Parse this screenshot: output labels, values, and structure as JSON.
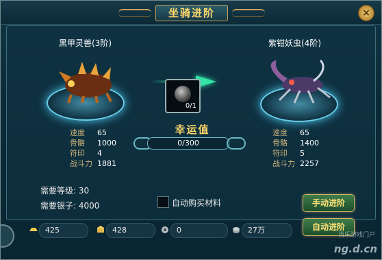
{
  "window": {
    "title": "坐骑进阶"
  },
  "current_mount": {
    "name": "黑甲灵兽(3阶)",
    "stats": [
      {
        "label": "速度",
        "value": "65"
      },
      {
        "label": "骨骼",
        "value": "1000"
      },
      {
        "label": "符印",
        "value": "4"
      },
      {
        "label": "战斗力",
        "value": "1881"
      }
    ]
  },
  "next_mount": {
    "name": "紫钳妖虫(4阶)",
    "stats": [
      {
        "label": "速度",
        "value": "65"
      },
      {
        "label": "骨骼",
        "value": "1400"
      },
      {
        "label": "符印",
        "value": "5"
      },
      {
        "label": "战斗力",
        "value": "2257"
      }
    ]
  },
  "material_slot": {
    "count": "0/1"
  },
  "luck": {
    "title": "幸运值",
    "value": "0/300",
    "progress": 0
  },
  "requirements": {
    "level": "需要等级: 30",
    "silver": "需要银子: 4000"
  },
  "auto_buy": {
    "label": "自动购买材料",
    "checked": false
  },
  "buttons": {
    "manual": "手动进阶",
    "auto": "自动进阶"
  },
  "currencies": [
    {
      "icon": "gold-ingot-icon",
      "value": "425"
    },
    {
      "icon": "gold-ticket-icon",
      "value": "428"
    },
    {
      "icon": "silver-coin-icon",
      "value": "0"
    },
    {
      "icon": "coin-stack-icon",
      "value": "27万"
    }
  ],
  "watermark": {
    "main": "ng.d.cn",
    "sub": "当乐游戏门户"
  },
  "colors": {
    "accent_gold": "#ffd86a",
    "stat_label": "#c9b277",
    "glow": "#69cde8",
    "button_green": "#2f6b3c"
  }
}
